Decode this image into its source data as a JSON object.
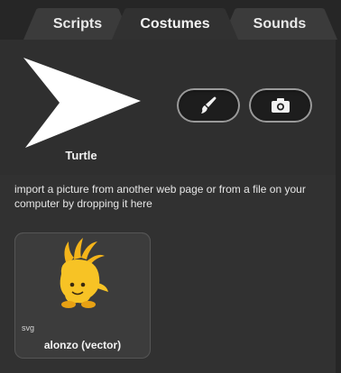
{
  "tabs": [
    {
      "label": "Scripts",
      "active": false
    },
    {
      "label": "Costumes",
      "active": true
    },
    {
      "label": "Sounds",
      "active": false
    }
  ],
  "sprite": {
    "name": "Turtle"
  },
  "buttons": {
    "paint_icon": "paintbrush-icon",
    "camera_icon": "camera-icon"
  },
  "help_text": "import a picture from another web page or from a file on your computer by dropping it here",
  "costumes": [
    {
      "name": "alonzo (vector)",
      "type": "svg"
    }
  ],
  "colors": {
    "background": "#313131",
    "tab_active": "#313131",
    "tab_inactive": "#3b3b3b",
    "text": "#ffffff"
  }
}
